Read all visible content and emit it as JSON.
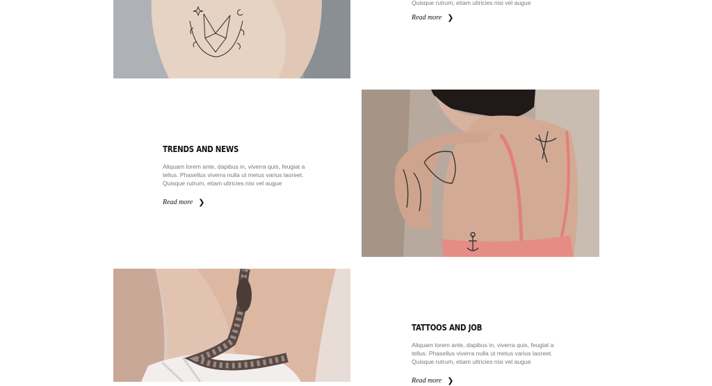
{
  "posts": [
    {
      "excerpt_tail": "Quisque rutrum, etiam ultricies nisi vel augue",
      "read_more": "Read more",
      "image": "fox-tattoo-on-thigh-photo"
    },
    {
      "title": "TRENDS AND NEWS",
      "excerpt": "Aliquam lorem ante, dapibus in, viverra quis, feugiat a tellus. Phasellus viverra nulla ut metus varius laoreet. Quisque rutrum, etiam ultricies nisi vel augue",
      "read_more": "Read more",
      "image": "tattooed-woman-back-photo"
    },
    {
      "title": "TATTOOS AND JOB",
      "excerpt": "Aliquam lorem ante, dapibus in, viverra quis, feugiat a tellus. Phasellus viverra nulla ut metus varius laoreet. Quisque rutrum, etiam ultricies nisi vel augue",
      "read_more": "Read more",
      "image": "snake-tattoo-on-ankle-photo"
    }
  ],
  "icons": {
    "read_more": "chevron-right-icon"
  },
  "colors": {
    "background": "#ffffff",
    "title": "#111111",
    "text": "#777777"
  }
}
